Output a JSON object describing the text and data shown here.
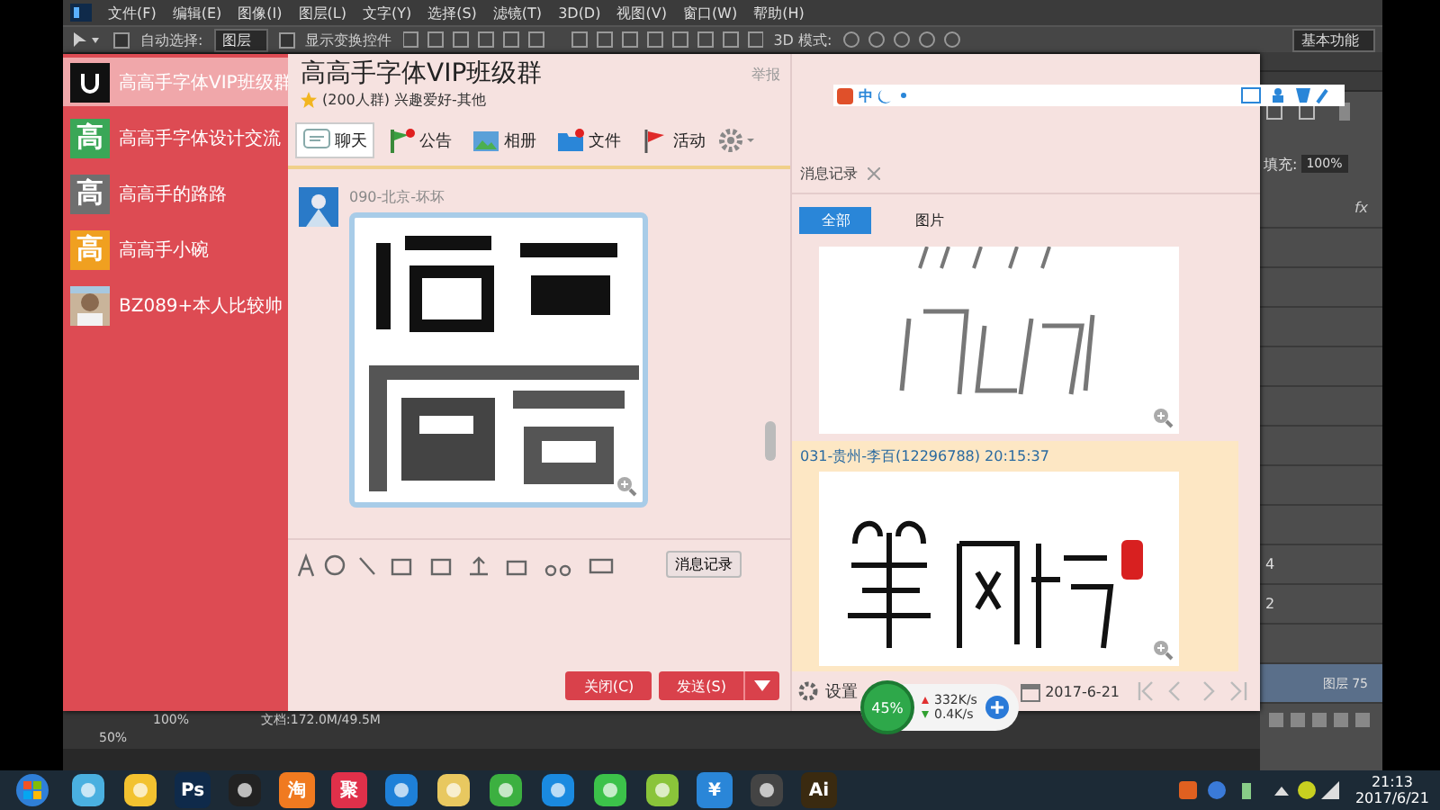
{
  "photoshop": {
    "menu": [
      "文件(F)",
      "编辑(E)",
      "图像(I)",
      "图层(L)",
      "文字(Y)",
      "选择(S)",
      "滤镜(T)",
      "3D(D)",
      "视图(V)",
      "窗口(W)",
      "帮助(H)"
    ],
    "options": {
      "auto_select_label": "自动选择:",
      "auto_select_checked": false,
      "auto_select_value": "图层",
      "transform_label": "显示变换控件",
      "transform_checked": false,
      "mode_3d_label": "3D 模式:",
      "workspace": "基本功能"
    },
    "layers_panel": {
      "fill_label": "填充:",
      "fill_value": "100%",
      "fx": "fx",
      "layer_numbers": [
        "4",
        "2"
      ],
      "selected_layer": "图层 75"
    },
    "status_bar": {
      "zoom": "100%",
      "document": "文档:172.0M/49.5M",
      "zoom_small": "50%"
    }
  },
  "ime_bar": {
    "mode": "中"
  },
  "qq": {
    "contacts": [
      {
        "name": "高高手字体VIP班级群",
        "selected": true,
        "kind": "logo"
      },
      {
        "name": "高高手字体设计交流",
        "selected": false,
        "kind": "glyph",
        "glyph": "高",
        "color": "#3aa757"
      },
      {
        "name": "高高手的路路",
        "selected": false,
        "kind": "glyph",
        "glyph": "高",
        "color": "#6f6f6f"
      },
      {
        "name": "高高手小碗",
        "selected": false,
        "kind": "glyph",
        "glyph": "高",
        "color": "#f0a020"
      },
      {
        "name": "BZ089+本人比较帅",
        "selected": false
      }
    ],
    "chat": {
      "title": "高高手字体VIP班级群",
      "subtitle": "(200人群) 兴趣爱好-其他",
      "report": "举报",
      "tabs": [
        {
          "label": "聊天",
          "kind": "chat",
          "selected": true,
          "dot": false
        },
        {
          "label": "公告",
          "kind": "notice",
          "selected": false,
          "dot": true
        },
        {
          "label": "相册",
          "kind": "album",
          "selected": false,
          "dot": false
        },
        {
          "label": "文件",
          "kind": "file",
          "selected": false,
          "dot": true
        },
        {
          "label": "活动",
          "kind": "activity",
          "selected": false,
          "dot": false
        }
      ],
      "sender": "090-北京-坏坏",
      "history_button": "消息记录",
      "close_button": "关闭(C)",
      "send_button": "发送(S)"
    },
    "history": {
      "title": "消息记录",
      "filters": [
        {
          "label": "全部",
          "selected": true
        },
        {
          "label": "图片",
          "selected": false
        }
      ],
      "entry_header": "031-贵州-李百(12296788) 20:15:37",
      "settings": "设置",
      "date": "2017-6-21"
    }
  },
  "speed_widget": {
    "percent": "45%",
    "upload": "332K/s",
    "download": "0.4K/s"
  },
  "taskbar": {
    "apps": [
      {
        "kind": "start",
        "color": "#2f7fd8"
      },
      {
        "kind": "app",
        "color": "#4ab0e0"
      },
      {
        "kind": "app",
        "color": "#f2c230"
      },
      {
        "kind": "app",
        "color": "#0f2a4a",
        "label": "Ps"
      },
      {
        "kind": "app",
        "color": "#222222"
      },
      {
        "kind": "app",
        "color": "#f07a20",
        "label": "淘"
      },
      {
        "kind": "app",
        "color": "#e0304a",
        "label": "聚"
      },
      {
        "kind": "app",
        "color": "#1e80d8"
      },
      {
        "kind": "app",
        "color": "#e8c860"
      },
      {
        "kind": "app",
        "color": "#3cb040"
      },
      {
        "kind": "app",
        "color": "#1a8ae0"
      },
      {
        "kind": "app",
        "color": "#3cc24a"
      },
      {
        "kind": "app",
        "color": "#8ac43a"
      },
      {
        "kind": "app",
        "color": "#2a86d8",
        "label": "¥"
      },
      {
        "kind": "app",
        "color": "#444444"
      },
      {
        "kind": "app",
        "color": "#3a2a10",
        "label": "Ai"
      }
    ],
    "time": "21:13",
    "date": "2017/6/21"
  }
}
